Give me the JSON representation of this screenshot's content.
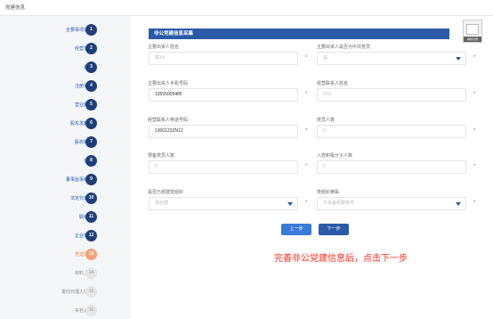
{
  "window": {
    "title": "党建信息"
  },
  "thumbnail": {
    "label": "填写示例"
  },
  "steps": [
    {
      "num": "1",
      "label": "全要事项选择",
      "state": "done"
    },
    {
      "num": "2",
      "label": "经营范围",
      "state": "done"
    },
    {
      "num": "3",
      "label": "名称",
      "state": "done"
    },
    {
      "num": "4",
      "label": "注册资本",
      "state": "done"
    },
    {
      "num": "5",
      "label": "营业期限",
      "state": "done"
    },
    {
      "num": "6",
      "label": "股东发起人",
      "state": "done"
    },
    {
      "num": "7",
      "label": "股权转让",
      "state": "done"
    },
    {
      "num": "8",
      "label": "住所",
      "state": "done"
    },
    {
      "num": "9",
      "label": "董事监事经理",
      "state": "done"
    },
    {
      "num": "10",
      "label": "法定代表人",
      "state": "done"
    },
    {
      "num": "11",
      "label": "联络员",
      "state": "done"
    },
    {
      "num": "12",
      "label": "企业章程",
      "state": "done"
    },
    {
      "num": "13",
      "label": "党建信息",
      "state": "active"
    },
    {
      "num": "14",
      "label": "材料上传",
      "state": "pending"
    },
    {
      "num": "15",
      "label": "委托代理人信息",
      "state": "pending"
    },
    {
      "num": "16",
      "label": "实名认证",
      "state": "pending"
    }
  ],
  "form": {
    "section_title": "非公党建信息采集",
    "fields": {
      "f1": {
        "label": "主要出资人姓名",
        "value": "",
        "placeholder": "陈XX"
      },
      "f2": {
        "label": "主要出资人是否为中共党员",
        "value": "",
        "placeholder": "是"
      },
      "f3": {
        "label": "主要出资人手机号码",
        "value": "13555005485",
        "placeholder": ""
      },
      "f4": {
        "label": "经营联系人姓名",
        "value": "",
        "placeholder": "刘三"
      },
      "f5": {
        "label": "经营联系人电话号码",
        "value": "1300123ZN12",
        "placeholder": ""
      },
      "f6": {
        "label": "党员人数",
        "value": "",
        "placeholder": "0"
      },
      "f7": {
        "label": "预备党员人数",
        "value": "",
        "placeholder": "0"
      },
      "f8": {
        "label": "入党积极分子人数",
        "value": "",
        "placeholder": "0"
      },
      "f9": {
        "label": "是否已组建党组织",
        "value": "",
        "placeholder": "未组建"
      },
      "f10": {
        "label": "党组织隶属",
        "value": "",
        "placeholder": "不具备组建条件"
      }
    },
    "required_mark": "*"
  },
  "buttons": {
    "prev": "上一步",
    "next": "下一步"
  },
  "annotation": "完善非公党建信息后，点击下一步",
  "colors": {
    "primary": "#2b5aa8",
    "active_step": "#f5a27a",
    "annotation": "#ff2a1a"
  }
}
